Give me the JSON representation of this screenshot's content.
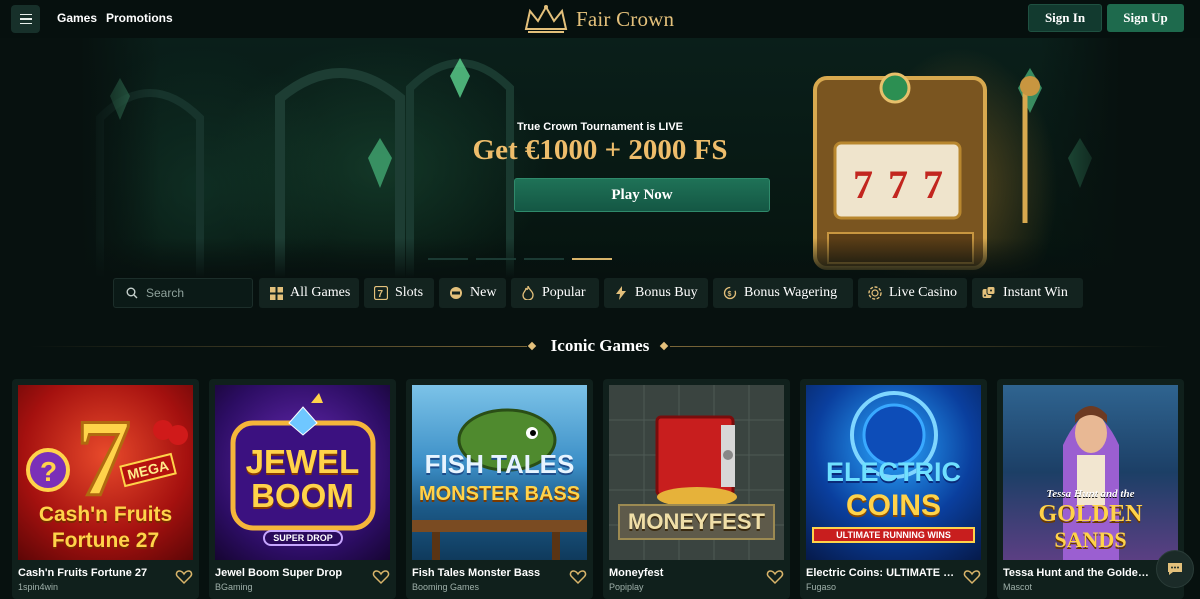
{
  "header": {
    "nav": [
      "Games",
      "Promotions"
    ],
    "brand": "Fair Crown",
    "sign_in": "Sign In",
    "sign_up": "Sign Up"
  },
  "hero": {
    "subtitle": "True Crown Tournament is LIVE",
    "title": "Get €1000 + 2000 FS",
    "cta": "Play Now",
    "slide_count": 4,
    "active_slide": 4
  },
  "search": {
    "placeholder": "Search"
  },
  "categories": [
    {
      "label": "All Games",
      "icon": "grid-icon"
    },
    {
      "label": "Slots",
      "icon": "slot-7-icon"
    },
    {
      "label": "New",
      "icon": "new-badge-icon"
    },
    {
      "label": "Popular",
      "icon": "flame-icon"
    },
    {
      "label": "Bonus Buy",
      "icon": "lightning-icon"
    },
    {
      "label": "Bonus Wagering",
      "icon": "coin-cycle-icon"
    },
    {
      "label": "Live Casino",
      "icon": "chip-icon"
    },
    {
      "label": "Instant Win",
      "icon": "dice-icon"
    }
  ],
  "section": {
    "title": "Iconic Games"
  },
  "games": [
    {
      "name": "Cash'n Fruits Fortune 27",
      "provider": "1spin4win",
      "art_lines": [
        "Cash'n Fruits",
        "Fortune 27"
      ],
      "art_badge": "MEGA"
    },
    {
      "name": "Jewel Boom Super Drop",
      "provider": "BGaming",
      "art_lines": [
        "JEWEL",
        "BOOM"
      ],
      "art_badge": "SUPER DROP"
    },
    {
      "name": "Fish Tales Monster Bass",
      "provider": "Booming Games",
      "art_lines": [
        "FISH TALES",
        "MONSTER BASS"
      ],
      "art_badge": ""
    },
    {
      "name": "Moneyfest",
      "provider": "Popiplay",
      "art_lines": [
        "MONEYFEST"
      ],
      "art_badge": ""
    },
    {
      "name": "Electric Coins: ULTIMATE R...",
      "provider": "Fugaso",
      "art_lines": [
        "ELECTRIC",
        "COINS"
      ],
      "art_badge": "ULTIMATE RUNNING WINS"
    },
    {
      "name": "Tessa Hunt and the Golden ...",
      "provider": "Mascot",
      "art_lines": [
        "Tessa Hunt and the",
        "GOLDEN",
        "SANDS"
      ],
      "art_badge": ""
    }
  ],
  "colors": {
    "background": "#07110f",
    "accent_gold": "#e3c07b",
    "primary_green": "#1e6a4d"
  }
}
